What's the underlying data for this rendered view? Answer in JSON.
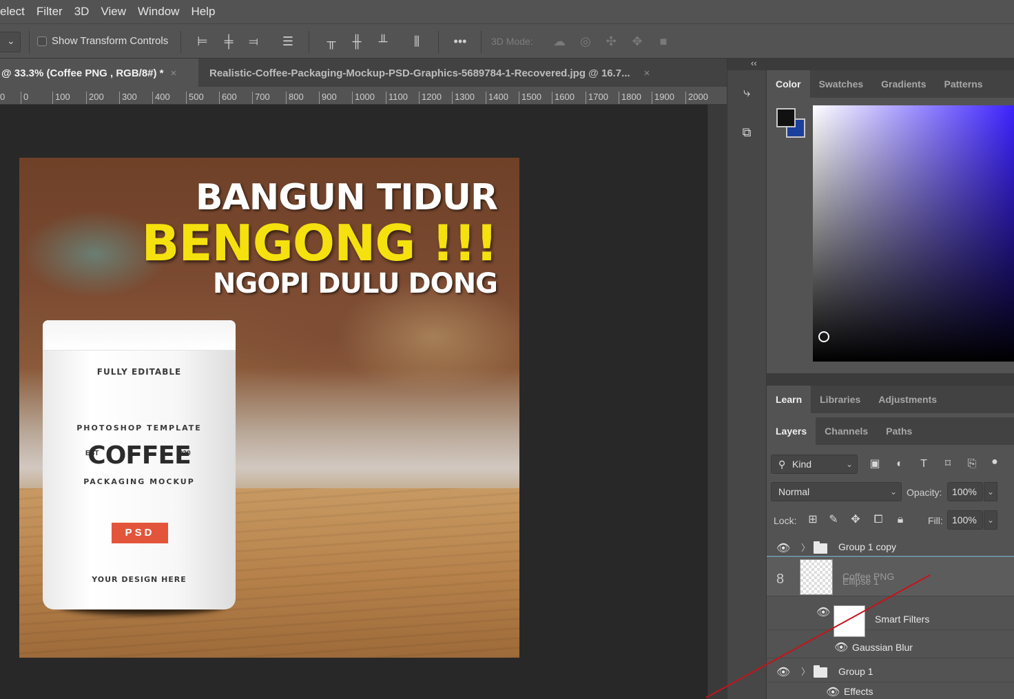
{
  "menu": [
    "elect",
    "Filter",
    "3D",
    "View",
    "Window",
    "Help"
  ],
  "options_bar": {
    "show_transform_controls": "Show Transform Controls",
    "mode_label": "3D Mode:"
  },
  "tabs": [
    {
      "label": "@ 33.3% (Coffee PNG , RGB/8#) *",
      "close": "×"
    },
    {
      "label": "Realistic-Coffee-Packaging-Mockup-PSD-Graphics-5689784-1-Recovered.jpg @ 16.7...",
      "close": "×"
    }
  ],
  "ruler": {
    "ticks": [
      "0",
      "0",
      "100",
      "200",
      "300",
      "400",
      "500",
      "600",
      "700",
      "800",
      "900",
      "1000",
      "1100",
      "1200",
      "1300",
      "1400",
      "1500",
      "1600",
      "1700",
      "1800",
      "1900",
      "2000"
    ]
  },
  "artwork": {
    "line1": "BANGUN TIDUR",
    "line2": "BENGONG !!!",
    "line3": "NGOPI DULU DONG",
    "bag": {
      "editable": "FULLY EDITABLE",
      "template": "PHOTOSHOP TEMPLATE",
      "est": "EST",
      "brand": "COFFEE",
      "year": "020",
      "mockup": "PACKAGING MOCKUP",
      "badge": "PSD",
      "design": "YOUR DESIGN HERE"
    }
  },
  "dock": {
    "collapse": "‹‹"
  },
  "color_panel": {
    "tabs": [
      "Color",
      "Swatches",
      "Gradients",
      "Patterns"
    ],
    "foreground": "#111111",
    "background": "#1b3f9c"
  },
  "learn_panel": {
    "tabs": [
      "Learn",
      "Libraries",
      "Adjustments"
    ]
  },
  "layers_panel": {
    "tabs": [
      "Layers",
      "Channels",
      "Paths"
    ],
    "filter_kind": "Kind",
    "blend_mode": "Normal",
    "opacity_label": "Opacity:",
    "opacity_value": "100%",
    "lock_label": "Lock:",
    "fill_label": "Fill:",
    "fill_value": "100%",
    "layers": [
      {
        "name": "Group 1 copy"
      },
      {
        "name": "Coffee PNG",
        "ghost": "Ellipse 1"
      },
      {
        "name": "Smart Filters"
      },
      {
        "name": "Gaussian Blur"
      },
      {
        "name": "Group 1"
      },
      {
        "name": "Effects"
      }
    ]
  }
}
